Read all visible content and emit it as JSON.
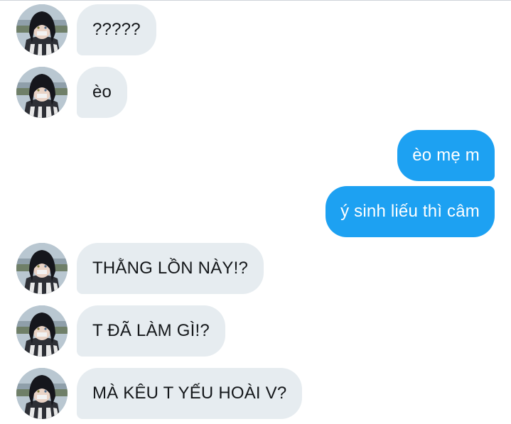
{
  "conversation": {
    "messages": [
      {
        "text": "?????",
        "sender": "other"
      },
      {
        "text": "èo",
        "sender": "other"
      },
      {
        "text": "èo mẹ m",
        "sender": "me"
      },
      {
        "text": "ý sinh liếu thì câm",
        "sender": "me"
      },
      {
        "text": "THẰNG LỒN NÀY!?",
        "sender": "other"
      },
      {
        "text": "T ĐÃ LÀM GÌ!?",
        "sender": "other"
      },
      {
        "text": "MÀ KÊU T YẾU HOÀI V?",
        "sender": "other"
      }
    ]
  },
  "colors": {
    "incoming_bubble": "#e6ecf0",
    "outgoing_bubble": "#1da1f2",
    "incoming_text": "#14171a",
    "outgoing_text": "#ffffff"
  }
}
